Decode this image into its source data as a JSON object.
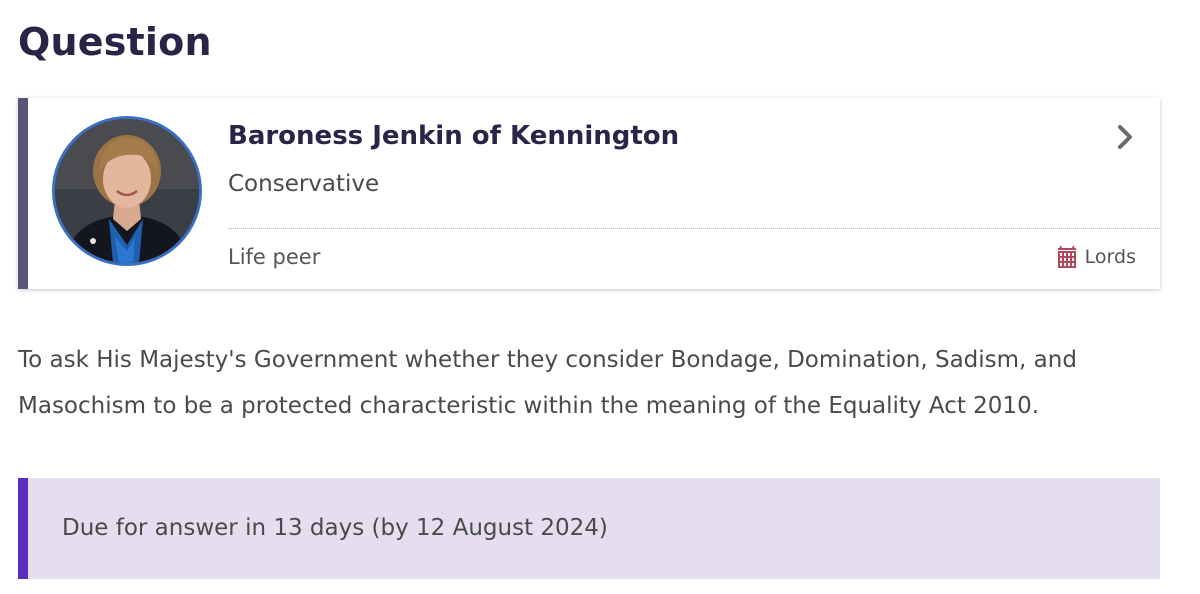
{
  "heading": {
    "title": "Question"
  },
  "member": {
    "name": "Baroness Jenkin of Kennington",
    "party": "Conservative",
    "type": "Life peer",
    "house": "Lords",
    "house_icon": "portcullis-icon",
    "link_icon": "chevron-right-icon"
  },
  "question": {
    "text": "To ask His Majesty's Government whether they consider Bondage, Domination, Sadism, and Masochism to be a protected characteristic within the meaning of the Equality Act 2010."
  },
  "status": {
    "due_text": "Due for answer in 13 days (by 12 August 2024)"
  },
  "colors": {
    "heading": "#2a2447",
    "card_accent": "#5b5478",
    "avatar_ring": "#3a6fc2",
    "lords_red": "#b04a5a",
    "due_background": "#e5def0",
    "due_accent": "#5a2fc0"
  }
}
